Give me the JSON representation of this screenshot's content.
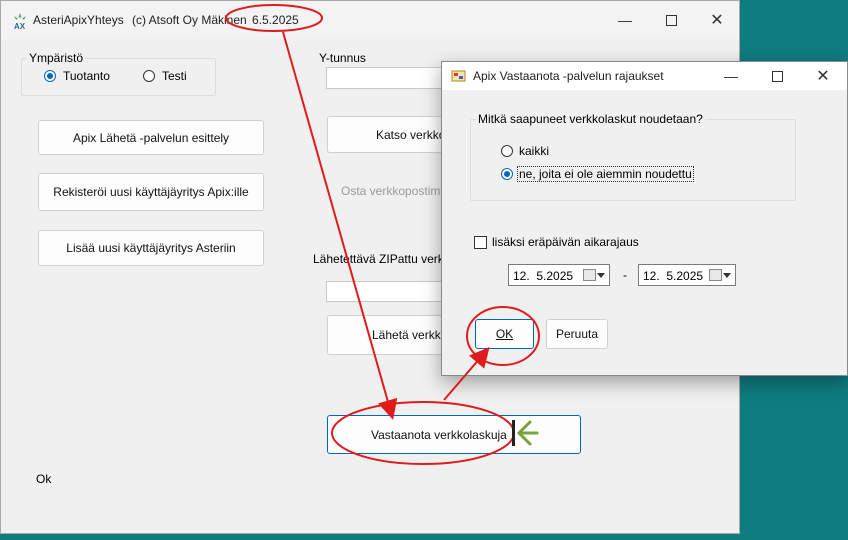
{
  "main_window": {
    "app_name": "AsteriApixYhteys",
    "copyright": "(c) Atsoft Oy Mäkinen",
    "date": "6.5.2025",
    "environment": {
      "label": "Ympäristö",
      "options": [
        "Tuotanto",
        "Testi"
      ],
      "selected": "Tuotanto"
    },
    "buttons": {
      "send_intro": "Apix Lähetä -palvelun esittely",
      "register_user": "Rekisteröi uusi käyttäjäyritys Apix:ille",
      "add_user": "Lisää uusi käyttäjäyritys Asteriin",
      "view_address": "Katso verkkop",
      "buy_address": "Osta verkkopostimerk",
      "send_invoices": "Lähetä verkkol",
      "receive_invoices": "Vastaanota verkkolaskuja"
    },
    "labels": {
      "business_id": "Y-tunnus",
      "zip_file": "Lähetettävä ZIPattu verk"
    },
    "status_text": "Ok"
  },
  "dialog": {
    "title": "Apix Vastaanota -palvelun rajaukset",
    "question": "Mitkä saapuneet verkkolaskut noudetaan?",
    "options": [
      "kaikki",
      "ne, joita ei ole aiemmin noudettu"
    ],
    "selected": "ne, joita ei ole aiemmin noudettu",
    "due_date_checkbox": "lisäksi eräpäivän aikarajaus",
    "due_date_checked": false,
    "date_from": "12.  5.2025",
    "date_separator": "-",
    "date_to": "12.  5.2025",
    "ok_label": "OK",
    "cancel_label": "Peruuta"
  },
  "annotation_colors": {
    "ellipse": "#e01b1b",
    "arrow": "#e01b1b",
    "pointer": "#7aa23c"
  }
}
